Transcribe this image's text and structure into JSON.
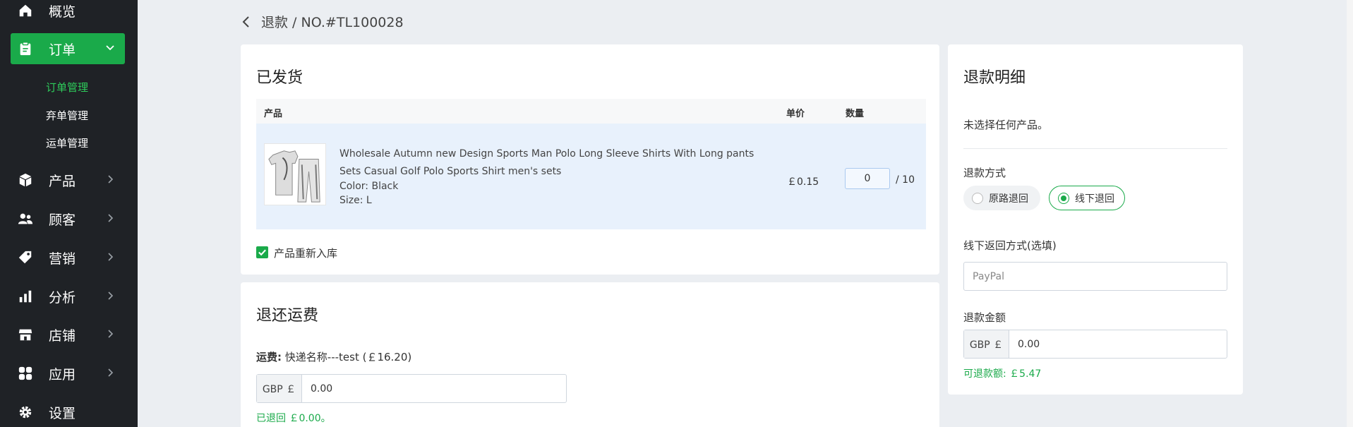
{
  "sidebar": {
    "items": [
      {
        "label": "概览",
        "icon": "home-icon"
      },
      {
        "label": "订单",
        "icon": "clipboard-icon"
      },
      {
        "label": "产品",
        "icon": "box-icon"
      },
      {
        "label": "顾客",
        "icon": "users-icon"
      },
      {
        "label": "营销",
        "icon": "tag-icon"
      },
      {
        "label": "分析",
        "icon": "bar-chart-icon"
      },
      {
        "label": "店铺",
        "icon": "store-icon"
      },
      {
        "label": "应用",
        "icon": "apps-icon"
      },
      {
        "label": "设置",
        "icon": "gear-icon"
      }
    ],
    "order_subitems": [
      "订单管理",
      "弃单管理",
      "运单管理"
    ],
    "active_color": "#1aaa4a"
  },
  "breadcrumb": {
    "text": "退款 / NO.#TL100028"
  },
  "shipped": {
    "title": "已发货",
    "columns": {
      "product": "产品",
      "unit_price": "单价",
      "quantity": "数量"
    },
    "item": {
      "name": "Wholesale Autumn new Design Sports Man Polo Long Sleeve Shirts With Long pants Sets Casual Golf Polo Sports Shirt men's sets",
      "color": "Color: Black",
      "size": "Size: L",
      "price": "￡0.15",
      "qty_value": "0",
      "qty_total": "/  10"
    },
    "restock_label": "产品重新入库"
  },
  "shipping": {
    "title": "退还运费",
    "fee_label": "运费:",
    "fee_value": "快递名称---test (￡16.20)",
    "currency": "GBP ￡",
    "amount": "0.00",
    "refunded": "已退回  ￡0.00。"
  },
  "refund": {
    "title": "退款明细",
    "empty": "未选择任何产品。",
    "method_label": "退款方式",
    "method_options": [
      "原路退回",
      "线下退回"
    ],
    "method_selected": "线下退回",
    "offline_label": "线下返回方式(选填)",
    "offline_placeholder": "PayPal",
    "amount_label": "退款金额",
    "currency": "GBP ￡",
    "amount": "0.00",
    "refundable": "可退款额:  ￡5.47"
  }
}
